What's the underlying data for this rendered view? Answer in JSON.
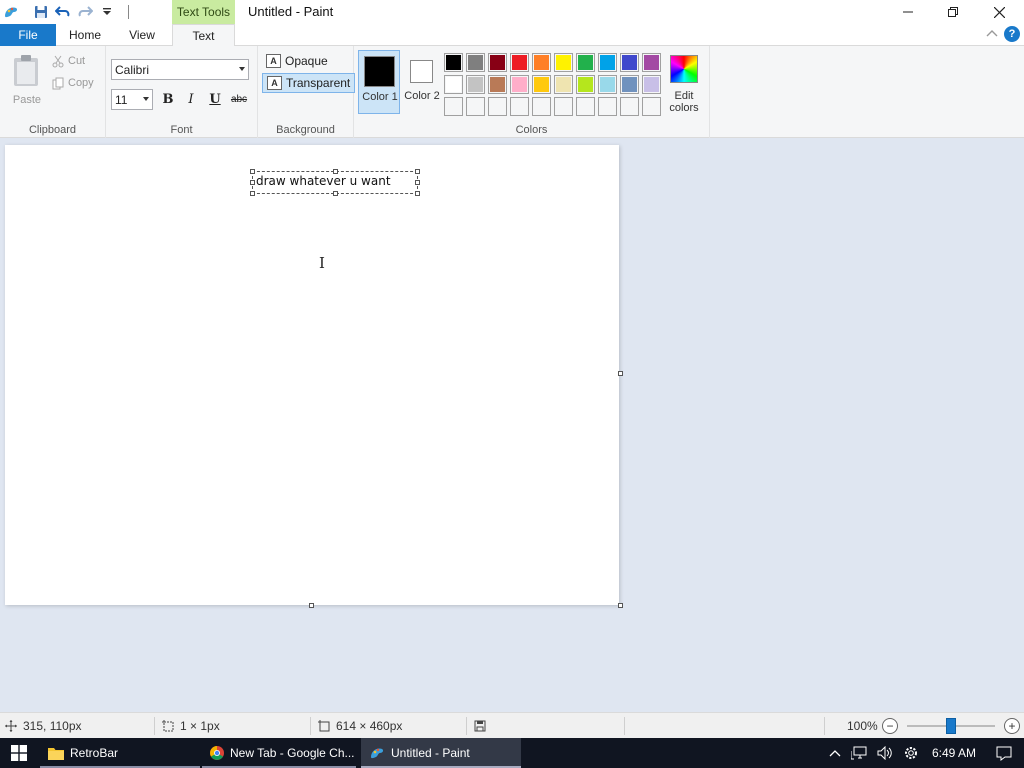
{
  "titlebar": {
    "context_tab_label": "Text Tools",
    "window_title": "Untitled - Paint"
  },
  "tabs": [
    {
      "label": "File"
    },
    {
      "label": "Home"
    },
    {
      "label": "View"
    },
    {
      "label": "Text"
    }
  ],
  "ribbon": {
    "clipboard": {
      "paste": "Paste",
      "cut": "Cut",
      "copy": "Copy",
      "group_label": "Clipboard"
    },
    "font": {
      "family": "Calibri",
      "size": "11",
      "bold": "B",
      "italic": "I",
      "underline": "U",
      "strike": "abc",
      "group_label": "Font"
    },
    "background": {
      "opaque": "Opaque",
      "transparent": "Transparent",
      "group_label": "Background"
    },
    "colors": {
      "color1_label": "Color 1",
      "color2_label": "Color 2",
      "color1_value": "#000000",
      "color2_value": "#ffffff",
      "edit_colors_label": "Edit colors",
      "group_label": "Colors",
      "palette_row1": [
        "#000000",
        "#7f7f7f",
        "#880015",
        "#ed1c24",
        "#ff7f27",
        "#fff200",
        "#22b14c",
        "#00a2e8",
        "#3f48cc",
        "#a349a4"
      ],
      "palette_row2": [
        "#ffffff",
        "#c3c3c3",
        "#b97a57",
        "#ffaec9",
        "#ffc90e",
        "#efe4b0",
        "#b5e61d",
        "#99d9ea",
        "#7092be",
        "#c8bfe7"
      ],
      "palette_row3": [
        "#f5f6f7",
        "#f5f6f7",
        "#f5f6f7",
        "#f5f6f7",
        "#f5f6f7",
        "#f5f6f7",
        "#f5f6f7",
        "#f5f6f7",
        "#f5f6f7",
        "#f5f6f7"
      ]
    }
  },
  "canvas": {
    "text_content": "draw whatever u want"
  },
  "statusbar": {
    "cursor_pos": "315, 110px",
    "selection_size": "1 × 1px",
    "canvas_size": "614 × 460px",
    "zoom": "100%",
    "zoom_level": 1.0
  },
  "taskbar": {
    "apps": [
      {
        "label": "RetroBar"
      },
      {
        "label": "New Tab - Google Ch..."
      },
      {
        "label": "Untitled - Paint"
      }
    ],
    "clock": "6:49 AM"
  }
}
